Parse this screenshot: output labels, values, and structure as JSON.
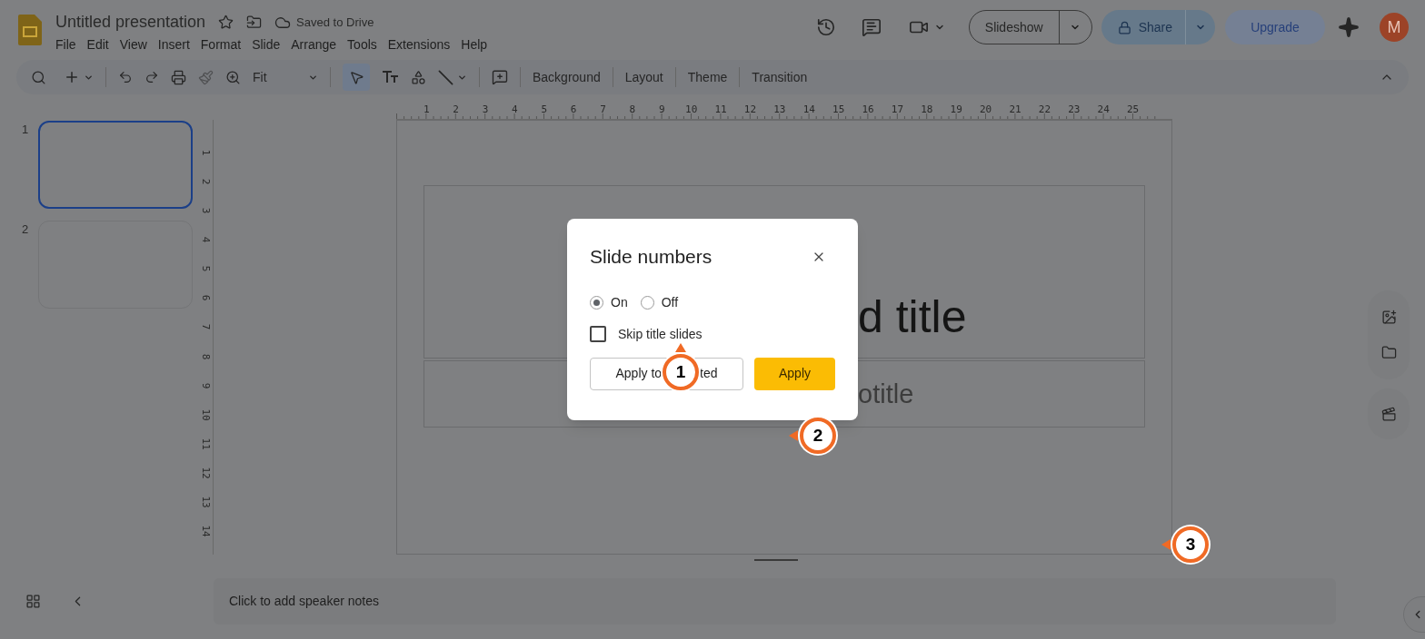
{
  "app": {
    "title": "Untitled presentation",
    "save_status": "Saved to Drive"
  },
  "menu": [
    "File",
    "Edit",
    "View",
    "Insert",
    "Format",
    "Slide",
    "Arrange",
    "Tools",
    "Extensions",
    "Help"
  ],
  "header": {
    "slideshow": "Slideshow",
    "share": "Share",
    "upgrade": "Upgrade",
    "avatar": "M"
  },
  "toolbar": {
    "zoom": "Fit",
    "select_active": true,
    "items": [
      "Background",
      "Layout",
      "Theme",
      "Transition"
    ]
  },
  "ruler": {
    "horizontal": [
      "1",
      "2",
      "3",
      "4",
      "5",
      "6",
      "7",
      "8",
      "9",
      "10",
      "11",
      "12",
      "13",
      "14",
      "15",
      "16",
      "17",
      "18",
      "19",
      "20",
      "21",
      "22",
      "23",
      "24",
      "25"
    ],
    "vertical": [
      "1",
      "2",
      "3",
      "4",
      "5",
      "6",
      "7",
      "8",
      "9",
      "10",
      "11",
      "12",
      "13",
      "14"
    ]
  },
  "slides": [
    {
      "number": "1",
      "selected": true
    },
    {
      "number": "2",
      "selected": false
    }
  ],
  "slide": {
    "title_fragment": "d title",
    "subtitle_fragment": "otitle"
  },
  "notes": {
    "prompt": "Click to add speaker notes"
  },
  "dialog": {
    "title": "Slide numbers",
    "options": [
      {
        "label": "On",
        "selected": true
      },
      {
        "label": "Off",
        "selected": false
      }
    ],
    "skip_title_slides": {
      "label": "Skip title slides",
      "checked": false
    },
    "buttons": [
      {
        "kind": "secondary",
        "label_parts": [
          "Apply to",
          "ted"
        ]
      },
      {
        "kind": "primary",
        "label_parts": [
          "Apply"
        ]
      }
    ]
  },
  "callouts": [
    {
      "label": "1"
    },
    {
      "label": "2"
    },
    {
      "label": "3"
    }
  ]
}
